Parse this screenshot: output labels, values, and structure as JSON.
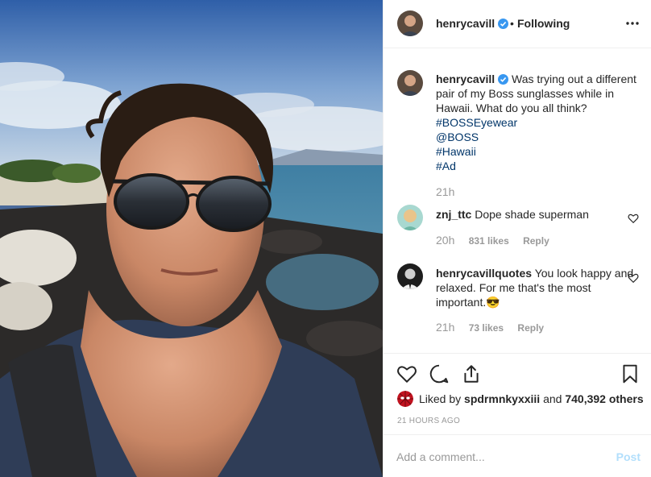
{
  "photo": {
    "alt_icon": "selfie-photo"
  },
  "header": {
    "username": "henrycavill",
    "dot": "•",
    "follow_label": "Following",
    "more_icon": "ellipsis-icon"
  },
  "caption": {
    "username": "henrycavill",
    "text": "Was trying out a different pair of my Boss sunglasses while in Hawaii. What do you all think?",
    "tags": [
      "#BOSSEyewear",
      "@BOSS",
      "#Hawaii",
      "#Ad"
    ],
    "time": "21h"
  },
  "comments": [
    {
      "username": "znj_ttc",
      "text": "Dope shade superman",
      "time": "20h",
      "likes": "831 likes",
      "reply": "Reply"
    },
    {
      "username": "henrycavillquotes",
      "text": "You look happy and relaxed. For me that's the most important.",
      "emoji": "😎",
      "time": "21h",
      "likes": "73 likes",
      "reply": "Reply"
    }
  ],
  "actions": {
    "liked_prefix": "Liked by",
    "liked_user": "spdrmnkyxxiii",
    "liked_and": "and",
    "liked_others": "740,392 others",
    "post_time": "21 HOURS AGO"
  },
  "add_comment": {
    "placeholder": "Add a comment...",
    "post_label": "Post"
  },
  "colors": {
    "link": "#003569",
    "verified": "#3897f0",
    "muted": "#999999",
    "post_disabled": "#b2dffc"
  }
}
